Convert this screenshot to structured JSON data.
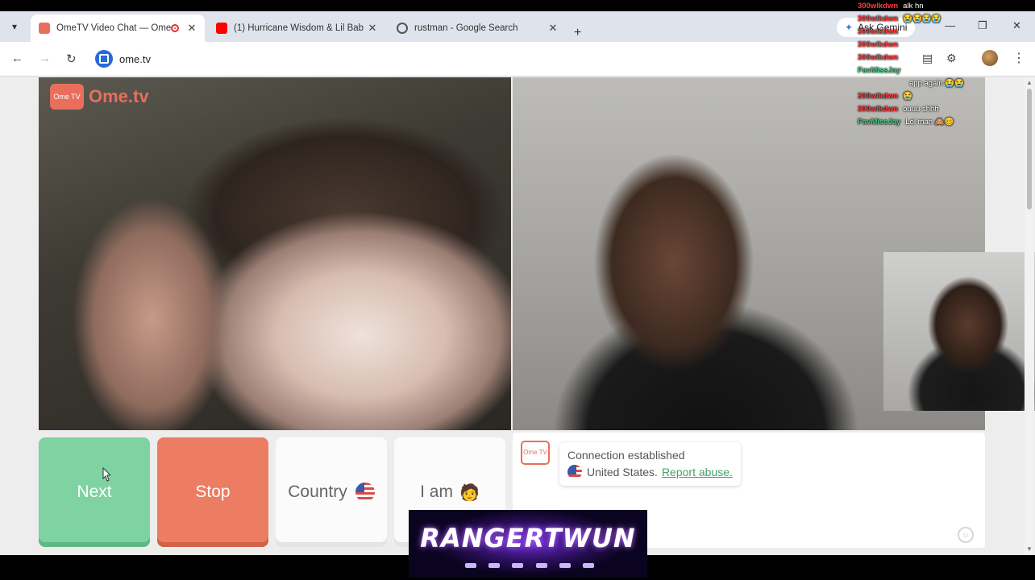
{
  "browser": {
    "tabs": [
      {
        "title": "OmeTV Video Chat — Ome",
        "active": true,
        "recording": true
      },
      {
        "title": "(1) Hurricane Wisdom & Lil Bab",
        "active": false
      },
      {
        "title": "rustman - Google Search",
        "active": false
      }
    ],
    "new_tab": "+",
    "gemini_label": "Ask Gemini",
    "url": "ome.tv"
  },
  "page": {
    "logo_text": "Ome.tv",
    "logo_box": "Ome TV",
    "buttons": {
      "next": "Next",
      "stop": "Stop",
      "country": "Country",
      "iam": "I am",
      "iam_emoji": "🧑"
    },
    "chat": {
      "logo": "Ome TV",
      "status": "Connection established",
      "country": "United States.",
      "report": "Report abuse."
    }
  },
  "stream": {
    "banner": "RANGERTWUN",
    "chat": [
      {
        "user": "300wlkdwn",
        "color": "#ff3b3b",
        "msg": "alk hn"
      },
      {
        "user": "300wlkdwn",
        "color": "#ff3b3b",
        "msg": "😭😭😭😭"
      },
      {
        "user": "300wlkdwn",
        "color": "#ff3b3b",
        "msg": ""
      },
      {
        "user": "300wlkdwn",
        "color": "#ff3b3b",
        "msg": ""
      },
      {
        "user": "300wlkdwn",
        "color": "#ff3b3b",
        "msg": ""
      },
      {
        "user": "FavMissJay",
        "color": "#3fd17a",
        "msg": ""
      },
      {
        "user": "",
        "color": "#ffffff",
        "msg": "app again 😭😭"
      },
      {
        "user": "300wlkdwn",
        "color": "#ff3b3b",
        "msg": "😭"
      },
      {
        "user": "300wlkdwn",
        "color": "#ff3b3b",
        "msg": "ouuu shhh"
      },
      {
        "user": "FavMissJay",
        "color": "#3fd17a",
        "msg": "Lol man 🙈🥴"
      }
    ]
  },
  "colors": {
    "next": "#7fd2a2",
    "stop": "#ec7c62",
    "brand": "#e96f5c",
    "link": "#43a06a"
  }
}
